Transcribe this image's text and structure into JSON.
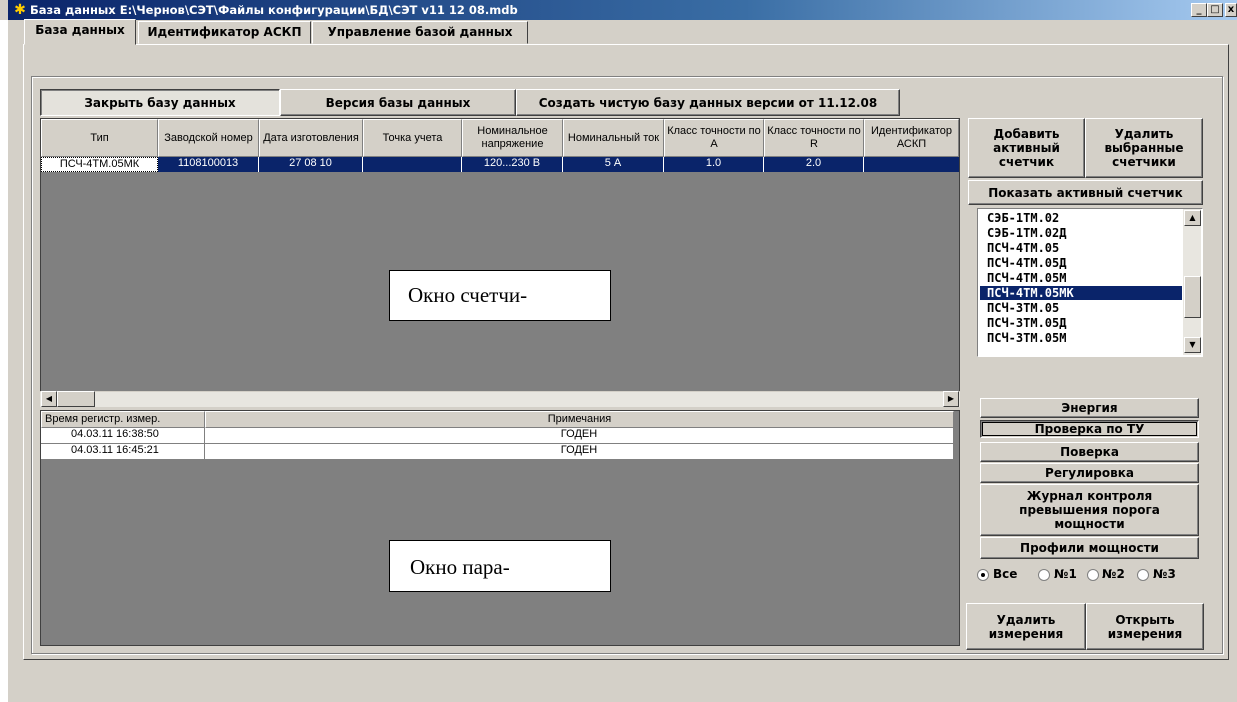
{
  "window": {
    "title": "База данных E:\\Чернов\\СЭТ\\Файлы конфигурации\\БД\\СЭТ v11 12 08.mdb",
    "minimize": "_",
    "maximize": "□",
    "close": "x"
  },
  "tabs": [
    "База данных",
    "Идентификатор АСКП",
    "Управление базой данных"
  ],
  "toolbar": {
    "close_db": "Закрыть базу данных",
    "db_version": "Версия базы данных",
    "create_db": "Создать чистую базу данных версии от 11.12.08"
  },
  "meters": {
    "columns": [
      "Тип",
      "Заводской номер",
      "Дата изготовления",
      "Точка учета",
      "Номинальное напряжение",
      "Номинальный ток",
      "Класс точности по А",
      "Класс точности по R",
      "Идентификатор АСКП"
    ],
    "rows": [
      [
        "ПСЧ-4ТМ.05МК",
        "1108100013",
        "27 08 10",
        "",
        "120...230 В",
        "5 А",
        "1.0",
        "2.0",
        ""
      ]
    ],
    "overlay_label": "Окно счетчи-"
  },
  "measurements": {
    "columns": [
      "Время регистр. измер.",
      "Примечания"
    ],
    "rows": [
      [
        "04.03.11 16:38:50",
        "ГОДЕН"
      ],
      [
        "04.03.11 16:45:21",
        "ГОДЕН"
      ]
    ],
    "overlay_label": "Окно пара-"
  },
  "side": {
    "add_active": "Добавить активный счетчик",
    "delete_selected": "Удалить выбранные счетчики",
    "show_active": "Показать активный счетчик",
    "meter_types": [
      "СЭБ-1ТМ.02",
      "СЭБ-1ТМ.02Д",
      "ПСЧ-4ТМ.05",
      "ПСЧ-4ТМ.05Д",
      "ПСЧ-4ТМ.05М",
      "ПСЧ-4ТМ.05МК",
      "ПСЧ-3ТМ.05",
      "ПСЧ-3ТМ.05Д",
      "ПСЧ-3ТМ.05М"
    ],
    "selected_type": "ПСЧ-4ТМ.05МК",
    "modes": [
      "Энергия",
      "Проверка по ТУ",
      "Поверка",
      "Регулировка",
      "Журнал контроля превышения порога мощности",
      "Профили мощности"
    ],
    "active_mode": "Проверка по ТУ",
    "radios": [
      "Все",
      "№1",
      "№2",
      "№3"
    ],
    "radio_selected": "Все",
    "delete_meas": "Удалить измерения",
    "open_meas": "Открыть измерения"
  },
  "icons": {
    "app": "app-icon",
    "scroll_left": "arrow-left-icon",
    "scroll_right": "arrow-right-icon",
    "scroll_up": "arrow-up-icon",
    "scroll_down": "arrow-down-icon"
  }
}
